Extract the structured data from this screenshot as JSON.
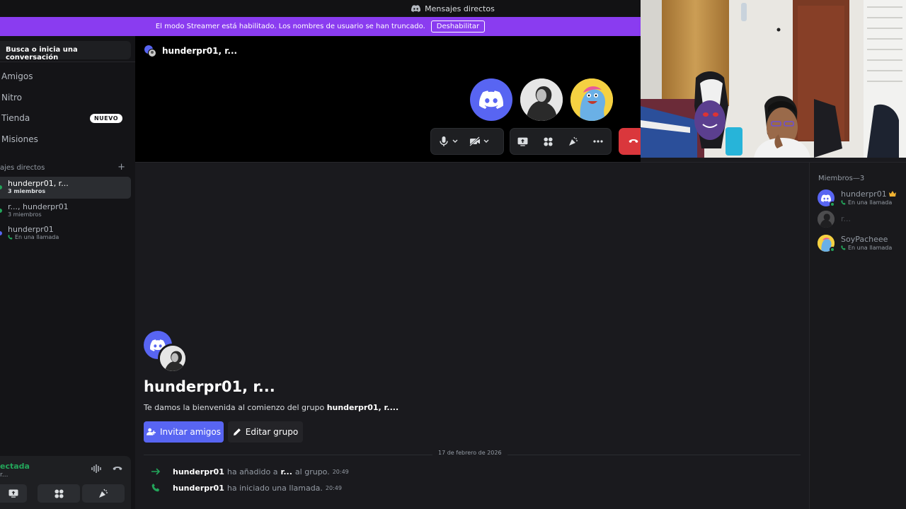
{
  "titlebar": {
    "title": "Mensajes directos"
  },
  "streamer": {
    "message": "El modo Streamer está habilitado. Los nombres de usuario se han truncado.",
    "button": "Deshabilitar"
  },
  "sidebar": {
    "search_placeholder": "Busca o inicia una conversación",
    "nav": [
      {
        "label": "Amigos"
      },
      {
        "label": "Nitro"
      },
      {
        "label": "Tienda",
        "badge": "NUEVO"
      },
      {
        "label": "Misiones"
      }
    ],
    "dm_header": "ajes directos",
    "dm_add": "+",
    "dms": [
      {
        "name": "hunderpr01, r...",
        "sub": "3 miembros"
      },
      {
        "name": "r..., hunderpr01",
        "sub": "3 miembros"
      },
      {
        "name": "hunderpr01",
        "sub": "En una llamada"
      }
    ],
    "voice": {
      "status": "ectada",
      "sub": "r..."
    }
  },
  "call": {
    "title": "hunderpr01, r..."
  },
  "members": {
    "header": "Miembros—3",
    "list": [
      {
        "name": "hunderpr01",
        "sub": "En una llamada"
      },
      {
        "name": "r...",
        "sub": ""
      },
      {
        "name": "SoyPacheee",
        "sub": "En una llamada"
      }
    ]
  },
  "welcome": {
    "title": "hunderpr01, r...",
    "sub_prefix": "Te damos la bienvenida al comienzo del grupo ",
    "sub_group": "hunderpr01, r....",
    "invite_button": "Invitar amigos",
    "edit_button": "Editar grupo"
  },
  "messages": {
    "date": "17 de febrero de 2026",
    "items": [
      {
        "user": "hunderpr01",
        "text_a": "ha añadido a",
        "target": "r...",
        "text_b": "al grupo.",
        "time": "20:49"
      },
      {
        "user": "hunderpr01",
        "text_a": "ha iniciado una llamada.",
        "time": "20:49"
      }
    ]
  },
  "colors": {
    "accent": "#5865f2",
    "streamer": "#8a3cf0",
    "online": "#23a55a",
    "danger": "#da373c"
  }
}
